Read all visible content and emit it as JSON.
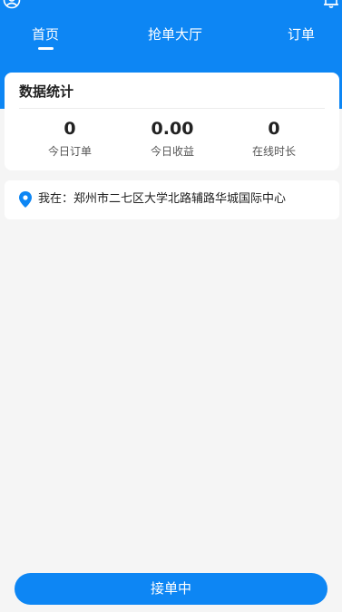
{
  "colors": {
    "primary": "#0d86f4",
    "background": "#f5f5f5",
    "card": "#ffffff",
    "text": "#222222",
    "muted": "#555555"
  },
  "icons": {
    "user": "user-circle-icon",
    "bell": "bell-icon",
    "location": "location-pin-icon"
  },
  "nav": {
    "tabs": [
      {
        "label": "首页",
        "active": true
      },
      {
        "label": "抢单大厅",
        "active": false
      },
      {
        "label": "订单",
        "active": false
      }
    ]
  },
  "stats": {
    "title": "数据统计",
    "items": [
      {
        "value": "0",
        "label": "今日订单"
      },
      {
        "value": "0.00",
        "label": "今日收益"
      },
      {
        "value": "0",
        "label": "在线时长"
      }
    ]
  },
  "location": {
    "text": "我在：郑州市二七区大学北路辅路华城国际中心"
  },
  "action": {
    "label": "接单中"
  }
}
